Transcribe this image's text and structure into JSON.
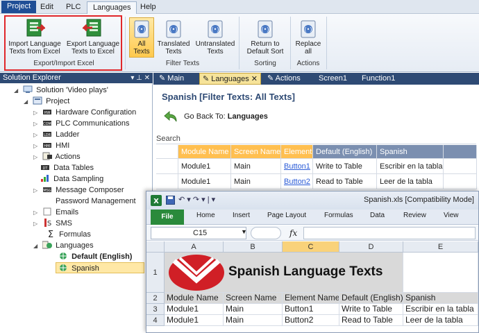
{
  "menu": {
    "tabs": [
      {
        "label": "Project"
      },
      {
        "label": "Edit"
      },
      {
        "label": "PLC"
      },
      {
        "label": "Languages"
      },
      {
        "label": "Help"
      }
    ]
  },
  "ribbon": {
    "import_btn": "Import Language\nTexts from Excel",
    "export_btn": "Export Language\nTexts to Excel",
    "group_export": "Export/Import Excel",
    "all_texts": "All\nTexts",
    "translated": "Translated\nTexts",
    "untranslated": "Untranslated\nTexts",
    "group_filter": "Filter Texts",
    "return_sort": "Return to\nDefault Sort",
    "group_sorting": "Sorting",
    "replace_all": "Replace\nall",
    "group_actions": "Actions",
    "highlight_color": "#e0262a"
  },
  "solution_explorer": {
    "title": "Solution Explorer",
    "controls": "▾ ⊥ ✕",
    "items": [
      {
        "label": "Solution 'Video plays'"
      },
      {
        "label": "Project"
      },
      {
        "label": "Hardware Configuration"
      },
      {
        "label": "PLC Communications"
      },
      {
        "label": "Ladder"
      },
      {
        "label": "HMI"
      },
      {
        "label": "Actions"
      },
      {
        "label": "Data Tables"
      },
      {
        "label": "Data Sampling"
      },
      {
        "label": "Message Composer"
      },
      {
        "label": "Password Management"
      },
      {
        "label": "Emails"
      },
      {
        "label": "SMS"
      },
      {
        "label": "Formulas"
      },
      {
        "label": "Languages"
      },
      {
        "label": "Default (English)"
      },
      {
        "label": "Spanish"
      }
    ]
  },
  "doc_tabs": [
    {
      "label": "Main"
    },
    {
      "label": "Languages"
    },
    {
      "label": "Actions"
    },
    {
      "label": "Screen1"
    },
    {
      "label": "Function1"
    }
  ],
  "doc": {
    "title": "Spanish [Filter Texts: All Texts]",
    "goto_prefix": "Go Back To: ",
    "goto_target": "Languages",
    "search_label": "Search",
    "columns": [
      "Module Name",
      "Screen Name",
      "Element",
      "Default (English)",
      "Spanish"
    ],
    "rows": [
      [
        "Module1",
        "Main",
        "Button1",
        "Write to Table",
        "Escribir en la tabla"
      ],
      [
        "Module1",
        "Main",
        "Button2",
        "Read to Table",
        "Leer de la tabla"
      ]
    ]
  },
  "excel": {
    "title": "Spanish.xls  [Compatibility Mode]",
    "qat": "↶ ▾  ↷ ▾ | ▾",
    "tabs": [
      "File",
      "Home",
      "Insert",
      "Page Layout",
      "Formulas",
      "Data",
      "Review",
      "View"
    ],
    "name_box": "C15",
    "fx": "fx",
    "col_letters": [
      "A",
      "B",
      "C",
      "D",
      "E"
    ],
    "row_numbers": [
      "1",
      "2",
      "3",
      "4"
    ],
    "banner_text": "Spanish Language Texts",
    "header_row": [
      "Module Name",
      "Screen Name",
      "Element Name",
      "Default (English)",
      "Spanish"
    ],
    "rows": [
      [
        "Module1",
        "Main",
        "Button1",
        "Write to Table",
        "Escribir en la tabla"
      ],
      [
        "Module1",
        "Main",
        "Button2",
        "Read to Table",
        "Leer de la tabla"
      ]
    ]
  }
}
